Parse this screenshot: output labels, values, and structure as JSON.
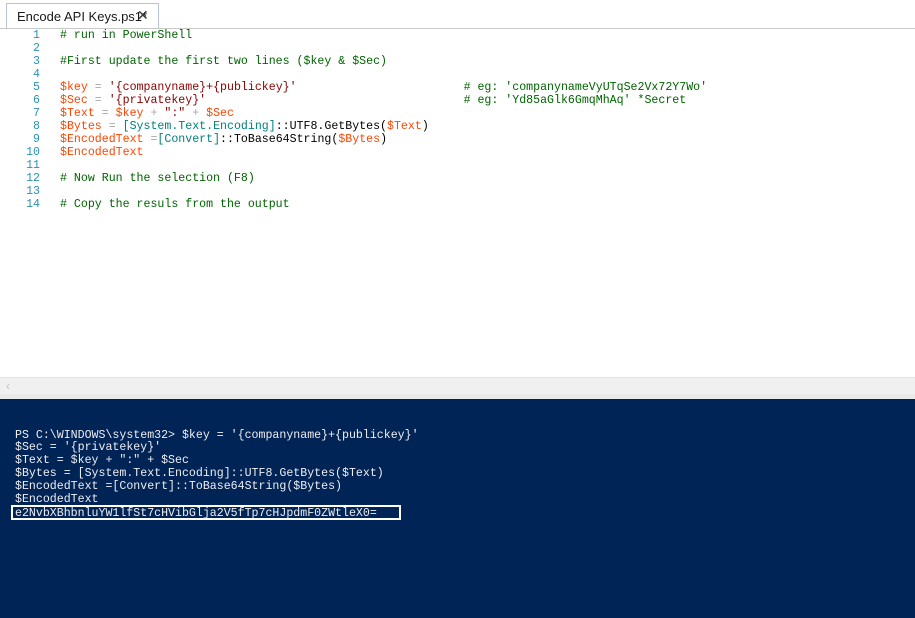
{
  "tab": {
    "title": "Encode API Keys.ps1*",
    "close_glyph": "✕"
  },
  "editor": {
    "lines": [
      {
        "n": "1",
        "parts": [
          {
            "t": "# run in PowerShell",
            "c": "comment"
          }
        ]
      },
      {
        "n": "2",
        "parts": []
      },
      {
        "n": "3",
        "parts": [
          {
            "t": "#First update the first two lines ($key & $Sec)",
            "c": "comment"
          }
        ]
      },
      {
        "n": "4",
        "parts": []
      },
      {
        "n": "5",
        "parts": [
          {
            "t": "$key",
            "c": "var"
          },
          {
            "t": " = ",
            "c": "op"
          },
          {
            "t": "'{companyname}+{publickey}'",
            "c": "str"
          },
          {
            "t": "                        ",
            "c": "plain"
          },
          {
            "t": "# eg: 'companynameVyUTqSe2Vx72Y7Wo'",
            "c": "comment"
          }
        ]
      },
      {
        "n": "6",
        "parts": [
          {
            "t": "$Sec",
            "c": "var"
          },
          {
            "t": " = ",
            "c": "op"
          },
          {
            "t": "'{privatekey}'",
            "c": "str"
          },
          {
            "t": "                                     ",
            "c": "plain"
          },
          {
            "t": "# eg: 'Yd85aGlk6GmqMhAq' *Secret",
            "c": "comment"
          }
        ]
      },
      {
        "n": "7",
        "parts": [
          {
            "t": "$Text",
            "c": "var"
          },
          {
            "t": " = ",
            "c": "op"
          },
          {
            "t": "$key",
            "c": "var"
          },
          {
            "t": " + ",
            "c": "op"
          },
          {
            "t": "\":\"",
            "c": "str"
          },
          {
            "t": " + ",
            "c": "op"
          },
          {
            "t": "$Sec",
            "c": "var"
          }
        ]
      },
      {
        "n": "8",
        "parts": [
          {
            "t": "$Bytes",
            "c": "var"
          },
          {
            "t": " = ",
            "c": "op"
          },
          {
            "t": "[System.Text.Encoding]",
            "c": "type"
          },
          {
            "t": "::UTF8.GetBytes(",
            "c": "plain"
          },
          {
            "t": "$Text",
            "c": "var"
          },
          {
            "t": ")",
            "c": "plain"
          }
        ]
      },
      {
        "n": "9",
        "parts": [
          {
            "t": "$EncodedText",
            "c": "var"
          },
          {
            "t": " =",
            "c": "op"
          },
          {
            "t": "[Convert]",
            "c": "type"
          },
          {
            "t": "::ToBase64String(",
            "c": "plain"
          },
          {
            "t": "$Bytes",
            "c": "var"
          },
          {
            "t": ")",
            "c": "plain"
          }
        ]
      },
      {
        "n": "10",
        "parts": [
          {
            "t": "$EncodedText",
            "c": "var"
          }
        ]
      },
      {
        "n": "11",
        "parts": []
      },
      {
        "n": "12",
        "parts": [
          {
            "t": "# Now Run the selection (F8)",
            "c": "comment"
          }
        ]
      },
      {
        "n": "13",
        "parts": []
      },
      {
        "n": "14",
        "parts": [
          {
            "t": "# Copy the resuls from the output",
            "c": "comment"
          }
        ]
      }
    ]
  },
  "scroll": {
    "left_arrow_glyph": "‹"
  },
  "console": {
    "lines": [
      "PS C:\\WINDOWS\\system32> $key = '{companyname}+{publickey}'",
      "$Sec = '{privatekey}'",
      "$Text = $key + \":\" + $Sec",
      "$Bytes = [System.Text.Encoding]::UTF8.GetBytes($Text)",
      "$EncodedText =[Convert]::ToBase64String($Bytes)",
      "$EncodedText",
      "e2NvbXBhbnluYW1lfSt7cHVibGlja2V5fTp7cHJpdmF0ZWtleX0="
    ]
  }
}
